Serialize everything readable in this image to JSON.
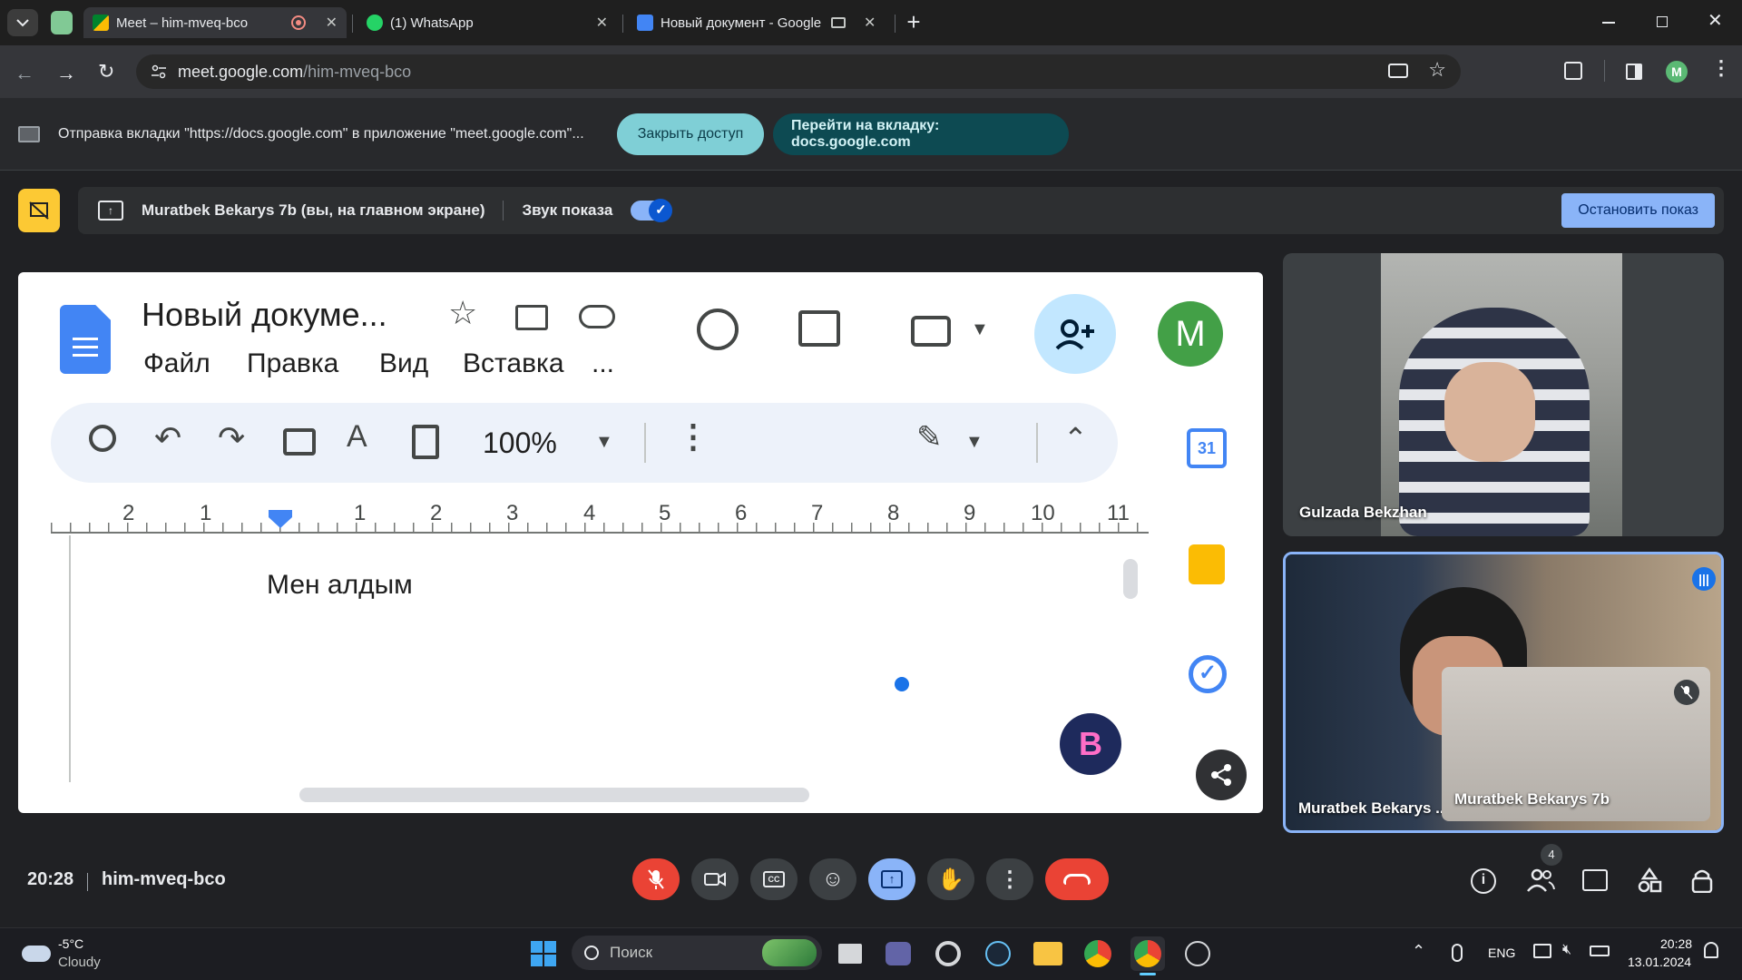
{
  "browser": {
    "tabs": [
      {
        "title": "Meet – him-mveq-bco",
        "active": true
      },
      {
        "title": "(1) WhatsApp",
        "active": false
      },
      {
        "title": "Новый документ - Google",
        "active": false
      }
    ],
    "url_domain": "meet.google.com",
    "url_path": "/him-mveq-bco",
    "profile_letter": "M"
  },
  "infobar": {
    "message": "Отправка вкладки \"https://docs.google.com\" в приложение \"meet.google.com\"...",
    "stop_sharing": "Закрыть доступ",
    "switch_tab": "Перейти на вкладку: docs.google.com"
  },
  "presentation": {
    "presenter": "Muratbek Bekarys 7b (вы, на главном экране)",
    "audio_label": "Звук показа",
    "audio_on": true,
    "stop_button": "Остановить показ"
  },
  "docs": {
    "title": "Новый докуме...",
    "menu": [
      "Файл",
      "Правка",
      "Вид",
      "Вставка",
      "..."
    ],
    "account_letter": "M",
    "zoom": "100%",
    "ruler_left": [
      "2",
      "1"
    ],
    "ruler_right": [
      "1",
      "2",
      "3",
      "4",
      "5",
      "6",
      "7",
      "8",
      "9",
      "10",
      "11"
    ],
    "body_text": "Мен алдым"
  },
  "participants": [
    {
      "name": "Gulzada Bekzhan"
    },
    {
      "name": "Muratbek Bekarys 7b",
      "speaking": true
    },
    {
      "name": "Muratbek Bekarys 7b",
      "truncated": "Muratbek Bekarys ..."
    }
  ],
  "meeting": {
    "time": "20:28",
    "code": "him-mveq-bco",
    "participants_count": "4"
  },
  "taskbar": {
    "weather_temp": "-5°C",
    "weather_desc": "Cloudy",
    "search_placeholder": "Поиск",
    "language": "ENG",
    "clock_time": "20:28",
    "clock_date": "13.01.2024"
  },
  "colors": {
    "docs_blue": "#4285f4",
    "meet_end_red": "#ea4335",
    "accent_light_blue": "#8ab4f8",
    "pill_teal": "#7fcfd6"
  }
}
